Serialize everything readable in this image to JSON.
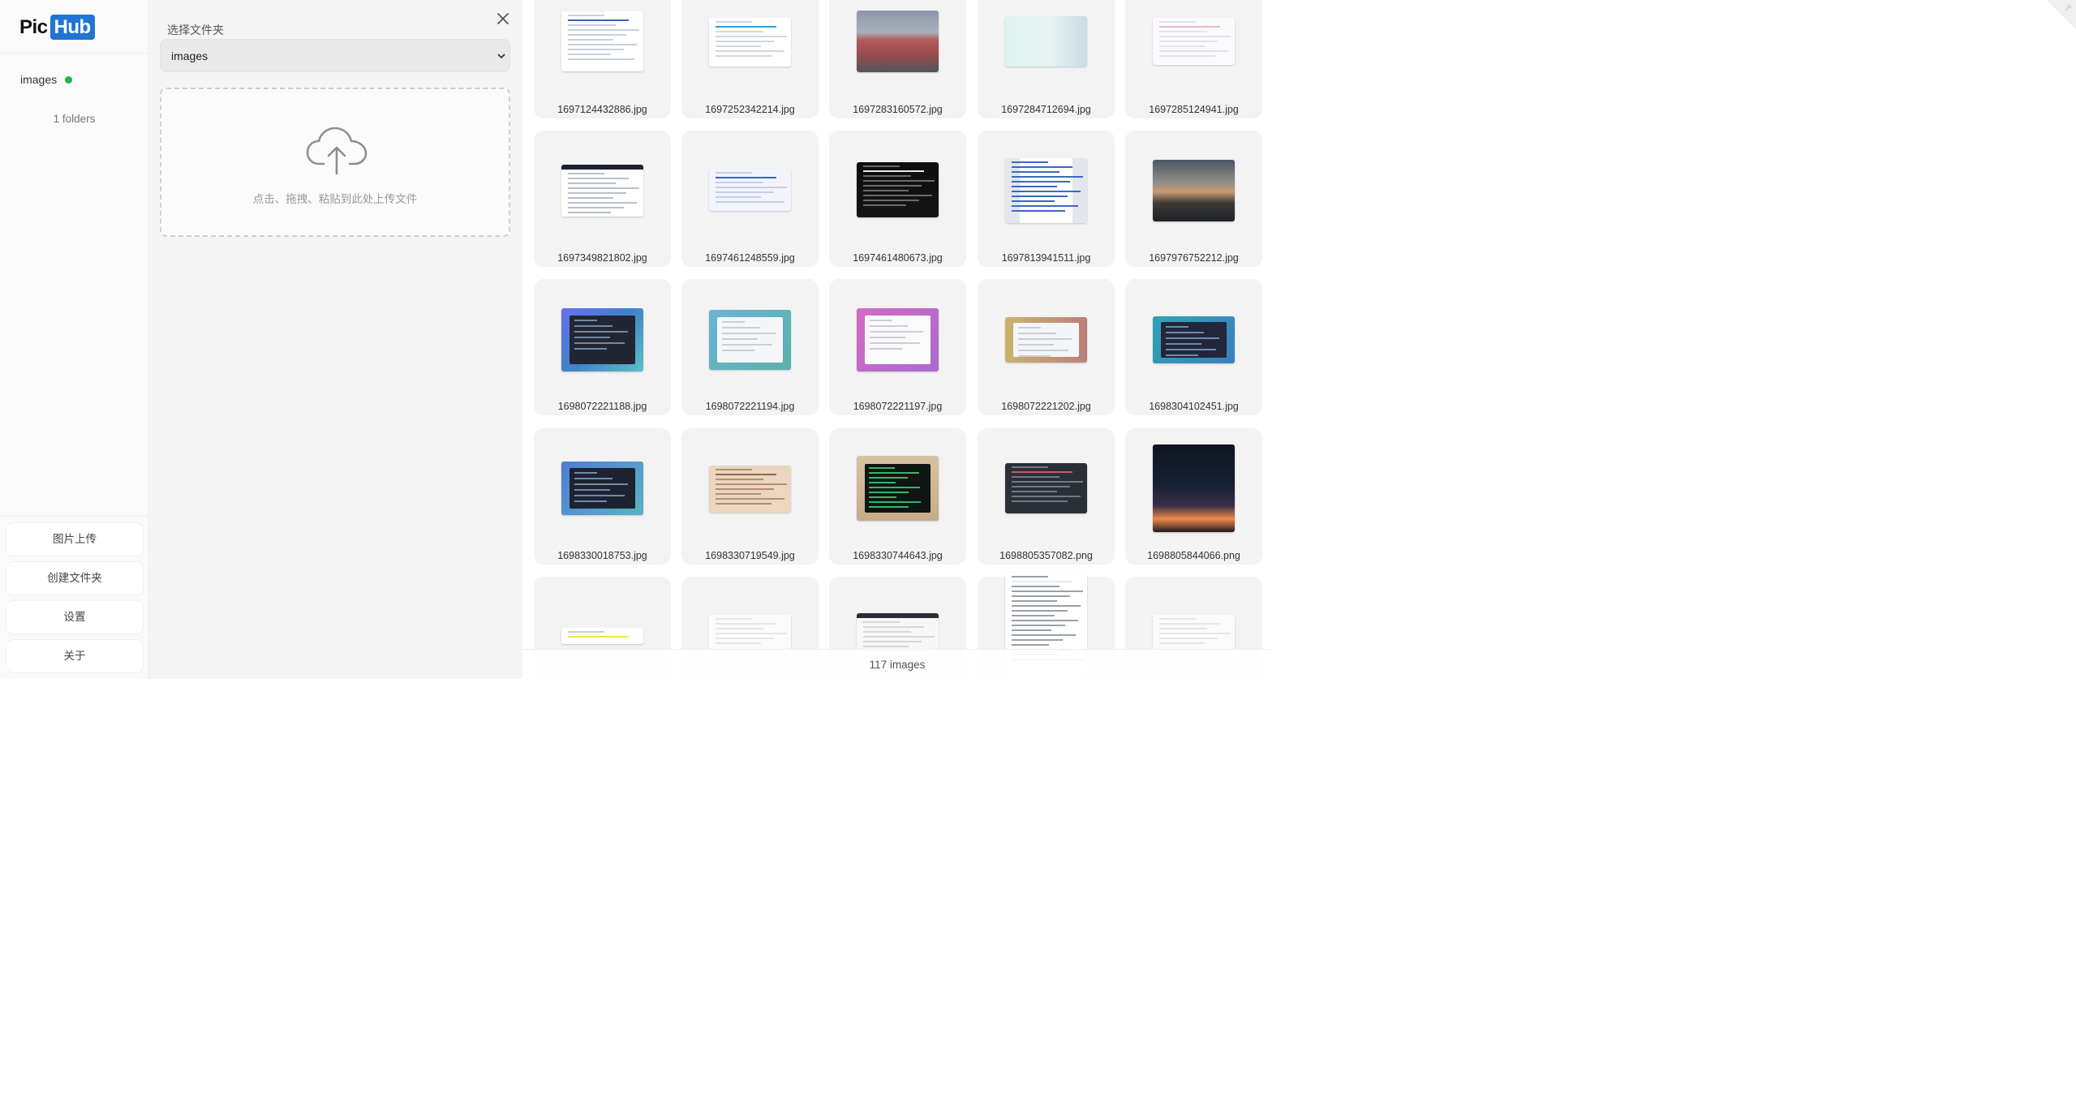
{
  "app": {
    "logo_pic": "Pic",
    "logo_hub": "Hub"
  },
  "sidebar": {
    "repo_name": "images",
    "repo_status_color": "#22b548",
    "folders_count": "1 folders",
    "buttons": [
      "图片上传",
      "创建文件夹",
      "设置",
      "关于"
    ]
  },
  "upload": {
    "folder_label": "选择文件夹",
    "selected_folder": "images",
    "drop_hint": "点击、拖拽、粘贴到此处上传文件"
  },
  "gallery": {
    "images": [
      {
        "name": "1697124432886.jpg",
        "style": "doc"
      },
      {
        "name": "1697252342214.jpg",
        "style": "doc2"
      },
      {
        "name": "1697283160572.jpg",
        "style": "photo-building"
      },
      {
        "name": "1697284712694.jpg",
        "style": "web-teal"
      },
      {
        "name": "1697285124941.jpg",
        "style": "web-light"
      },
      {
        "name": "1697349821802.jpg",
        "style": "web-brain"
      },
      {
        "name": "1697461248559.jpg",
        "style": "dashboard"
      },
      {
        "name": "1697461480673.jpg",
        "style": "devices"
      },
      {
        "name": "1697813941511.jpg",
        "style": "doc-list"
      },
      {
        "name": "1697976752212.jpg",
        "style": "photo-sunset"
      },
      {
        "name": "1698072221188.jpg",
        "style": "code-blue"
      },
      {
        "name": "1698072221194.jpg",
        "style": "app-teal"
      },
      {
        "name": "1698072221197.jpg",
        "style": "app-pink"
      },
      {
        "name": "1698072221202.jpg",
        "style": "app-gold"
      },
      {
        "name": "1698304102451.jpg",
        "style": "app-cyan"
      },
      {
        "name": "1698330018753.jpg",
        "style": "code-blue2"
      },
      {
        "name": "1698330719549.jpg",
        "style": "paper"
      },
      {
        "name": "1698330744643.jpg",
        "style": "terminal-green"
      },
      {
        "name": "1698805357082.png",
        "style": "terminal-dark"
      },
      {
        "name": "1698805844066.png",
        "style": "social-dark"
      },
      {
        "name": "",
        "style": "doc-yellow"
      },
      {
        "name": "",
        "style": "blank"
      },
      {
        "name": "",
        "style": "doc-header"
      },
      {
        "name": "",
        "style": "doc-long"
      },
      {
        "name": "",
        "style": "blank"
      }
    ],
    "total": "117 images"
  }
}
